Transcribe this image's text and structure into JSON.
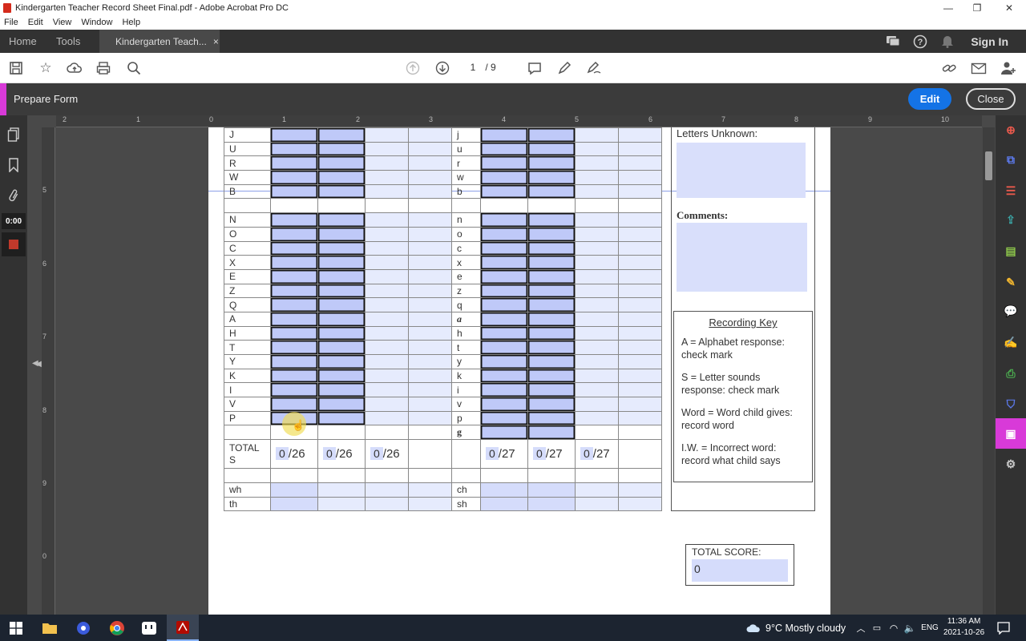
{
  "window": {
    "title": "Kindergarten Teacher Record Sheet Final.pdf - Adobe Acrobat Pro DC"
  },
  "menu": [
    "File",
    "Edit",
    "View",
    "Window",
    "Help"
  ],
  "tabs": {
    "home": "Home",
    "tools": "Tools",
    "doc": "Kindergarten Teach...",
    "close": "×"
  },
  "header": {
    "signin": "Sign In"
  },
  "toolbar": {
    "page_current": "1",
    "page_total": "/ 9"
  },
  "formbar": {
    "title": "Prepare Form",
    "edit": "Edit",
    "close": "Close"
  },
  "leftnav": {
    "timer": "0:00"
  },
  "ruler": {
    "h": [
      "2",
      "1",
      "0",
      "1",
      "2",
      "3",
      "4",
      "5",
      "6",
      "7",
      "8",
      "9",
      "10"
    ],
    "v": [
      "5",
      "6",
      "7",
      "8",
      "9",
      "0"
    ]
  },
  "form": {
    "upper_a": [
      "J",
      "U",
      "R",
      "W",
      "B"
    ],
    "lower_a": [
      "j",
      "u",
      "r",
      "w",
      "b"
    ],
    "upper_b": [
      "N",
      "O",
      "C",
      "X",
      "E",
      "Z",
      "Q",
      "A",
      "H",
      "T",
      "Y",
      "K",
      "I",
      "V",
      "P"
    ],
    "lower_b": [
      "n",
      "o",
      "c",
      "x",
      "e",
      "z",
      "q",
      "a",
      "h",
      "t",
      "y",
      "k",
      "i",
      "v",
      "p"
    ],
    "lower_extra": "g",
    "totals_label": "TOTAL S",
    "totals_upper": [
      {
        "v": "0",
        "d": "/26"
      },
      {
        "v": "0",
        "d": "/26"
      },
      {
        "v": "0",
        "d": "/26"
      }
    ],
    "totals_lower": [
      {
        "v": "0",
        "d": "/27"
      },
      {
        "v": "0",
        "d": "/27"
      },
      {
        "v": "0",
        "d": "/27"
      }
    ],
    "digraphs_left": [
      "wh",
      "th"
    ],
    "digraphs_right": [
      "ch",
      "sh"
    ]
  },
  "side": {
    "letters_unknown": "Letters Unknown:",
    "comments": "Comments:",
    "key_title": "Recording Key",
    "key_items": [
      "A = Alphabet response: check mark",
      "S = Letter sounds response: check mark",
      "Word = Word child gives: record word",
      "I.W. = Incorrect word: record what child says"
    ],
    "total_score_label": "TOTAL SCORE:",
    "total_score_value": "0"
  },
  "taskbar": {
    "weather": "9°C  Mostly cloudy",
    "lang": "ENG",
    "time": "11:36 AM",
    "date": "2021-10-26"
  },
  "colors": {
    "accent": "#1473e6",
    "form_field": "#d5dcfb",
    "prepare_accent": "#d83ad8"
  }
}
